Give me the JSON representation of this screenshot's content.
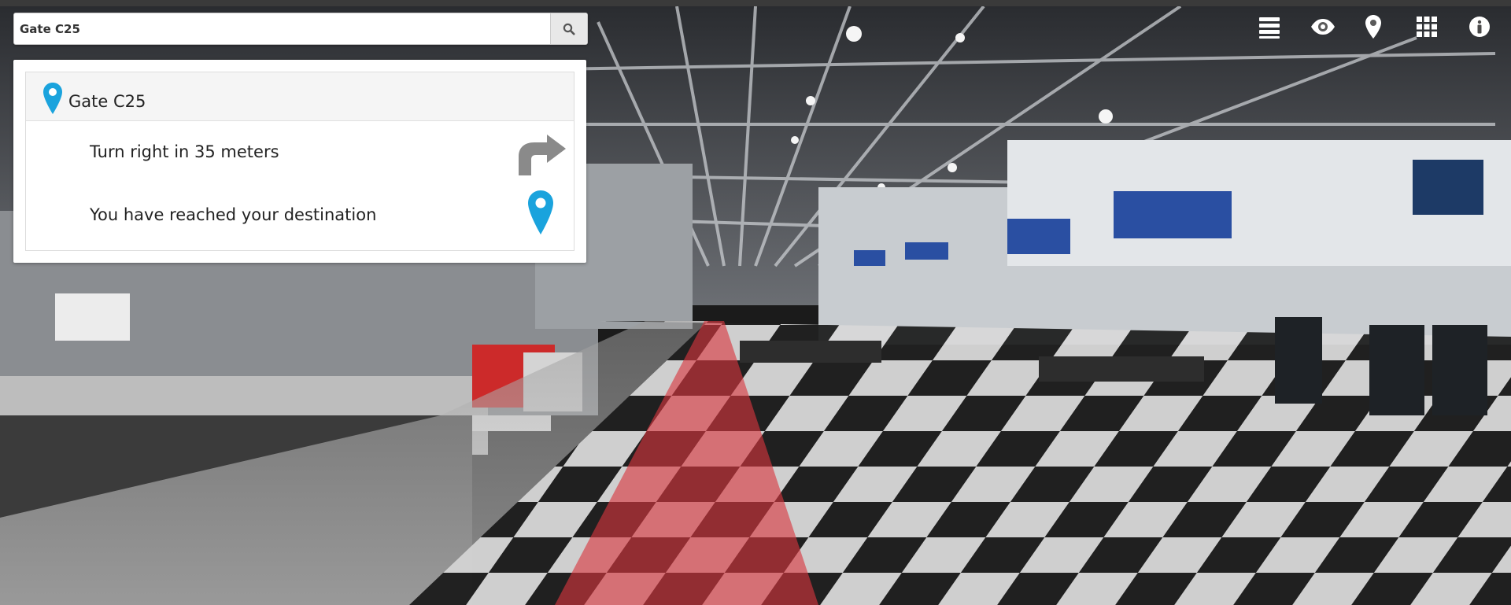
{
  "search": {
    "value": "Gate C25",
    "placeholder": ""
  },
  "route": {
    "destination": "Gate C25",
    "steps": [
      {
        "text": "Turn right in 35 meters",
        "icon": "turn-right-arrow-icon"
      },
      {
        "text": "You have reached your destination",
        "icon": "map-pin-icon"
      }
    ]
  },
  "toolbar": {
    "icons": [
      "list-icon",
      "eye-icon",
      "map-marker-icon",
      "grid-icon",
      "info-icon"
    ]
  },
  "colors": {
    "accent": "#1aa3dd",
    "path": "#d9363e",
    "arrow": "#8a8a8a"
  }
}
